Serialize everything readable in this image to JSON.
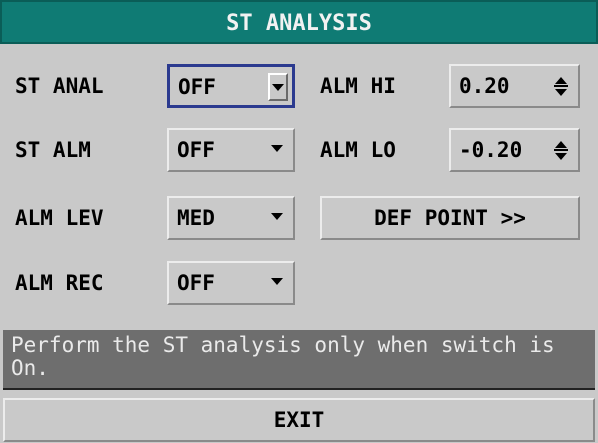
{
  "title": "ST ANALYSIS",
  "left": {
    "st_anal": {
      "label": "ST ANAL",
      "value": "OFF"
    },
    "st_alm": {
      "label": "ST ALM",
      "value": "OFF"
    },
    "alm_lev": {
      "label": "ALM LEV",
      "value": "MED"
    },
    "alm_rec": {
      "label": "ALM REC",
      "value": "OFF"
    }
  },
  "right": {
    "alm_hi": {
      "label": "ALM HI",
      "value": "0.20"
    },
    "alm_lo": {
      "label": "ALM LO",
      "value": "-0.20"
    },
    "def_point_label": "DEF POINT >>"
  },
  "help_text": "Perform the ST analysis only when switch is On.",
  "exit_label": "EXIT",
  "colors": {
    "title_bg": "#0f7b74",
    "panel_bg": "#c9c9c9",
    "help_bg": "#6e6e6e",
    "focus_border": "#2b3a8f"
  }
}
